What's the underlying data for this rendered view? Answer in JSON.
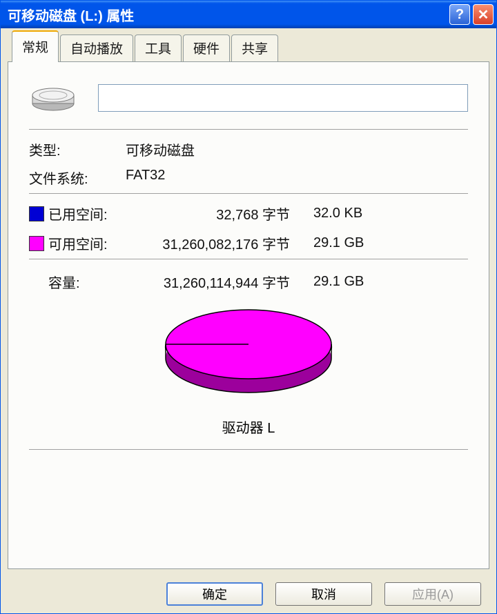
{
  "window": {
    "title": "可移动磁盘 (L:) 属性"
  },
  "tabs": [
    "常规",
    "自动播放",
    "工具",
    "硬件",
    "共享"
  ],
  "active_tab_index": 0,
  "general": {
    "drive_name_value": "",
    "type_label": "类型:",
    "type_value": "可移动磁盘",
    "fs_label": "文件系统:",
    "fs_value": "FAT32",
    "used_label": "已用空间:",
    "used_bytes": "32,768 字节",
    "used_human": "32.0 KB",
    "free_label": "可用空间:",
    "free_bytes": "31,260,082,176 字节",
    "free_human": "29.1 GB",
    "capacity_label": "容量:",
    "capacity_bytes": "31,260,114,944 字节",
    "capacity_human": "29.1 GB",
    "drive_caption": "驱动器 L"
  },
  "buttons": {
    "ok": "确定",
    "cancel": "取消",
    "apply": "应用(A)"
  },
  "colors": {
    "used": "#0000d4",
    "free": "#ff00ff",
    "side": "#9c009c"
  },
  "chart_data": {
    "type": "pie",
    "title": "驱动器 L",
    "series": [
      {
        "name": "已用空间",
        "value": 32768,
        "color": "#0000d4"
      },
      {
        "name": "可用空间",
        "value": 31260082176,
        "color": "#ff00ff"
      }
    ],
    "total": 31260114944
  }
}
